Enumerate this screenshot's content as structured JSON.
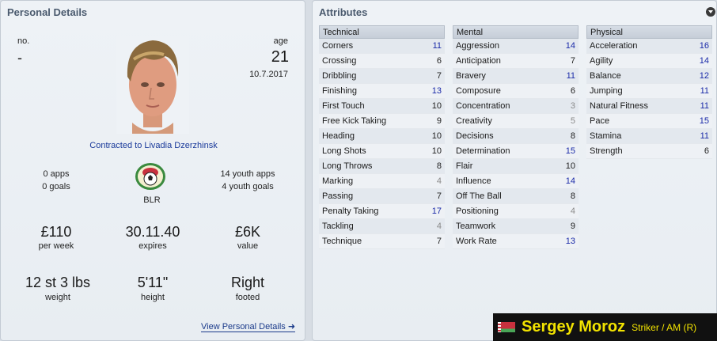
{
  "personal": {
    "title": "Personal Details",
    "no_label": "no.",
    "no_value": "-",
    "age_label": "age",
    "age_value": "21",
    "dob": "10.7.2017",
    "contract": "Contracted to Livadia Dzerzhinsk",
    "apps": "0 apps",
    "goals": "0 goals",
    "nation": "BLR",
    "youth_apps": "14 youth apps",
    "youth_goals": "4 youth goals",
    "wage": "£110",
    "wage_label": "per week",
    "expires": "30.11.40",
    "expires_label": "expires",
    "value": "£6K",
    "value_label": "value",
    "weight": "12 st 3 lbs",
    "weight_label": "weight",
    "height": "5'11\"",
    "height_label": "height",
    "footed": "Right",
    "footed_label": "footed",
    "view_link": "View Personal Details"
  },
  "attributes": {
    "title": "Attributes",
    "technical": {
      "header": "Technical",
      "items": [
        {
          "name": "Corners",
          "value": "11"
        },
        {
          "name": "Crossing",
          "value": "6"
        },
        {
          "name": "Dribbling",
          "value": "7"
        },
        {
          "name": "Finishing",
          "value": "13"
        },
        {
          "name": "First Touch",
          "value": "10"
        },
        {
          "name": "Free Kick Taking",
          "value": "9"
        },
        {
          "name": "Heading",
          "value": "10"
        },
        {
          "name": "Long Shots",
          "value": "10"
        },
        {
          "name": "Long Throws",
          "value": "8"
        },
        {
          "name": "Marking",
          "value": "4"
        },
        {
          "name": "Passing",
          "value": "7"
        },
        {
          "name": "Penalty Taking",
          "value": "17"
        },
        {
          "name": "Tackling",
          "value": "4"
        },
        {
          "name": "Technique",
          "value": "7"
        }
      ]
    },
    "mental": {
      "header": "Mental",
      "items": [
        {
          "name": "Aggression",
          "value": "14"
        },
        {
          "name": "Anticipation",
          "value": "7"
        },
        {
          "name": "Bravery",
          "value": "11"
        },
        {
          "name": "Composure",
          "value": "6"
        },
        {
          "name": "Concentration",
          "value": "3"
        },
        {
          "name": "Creativity",
          "value": "5"
        },
        {
          "name": "Decisions",
          "value": "8"
        },
        {
          "name": "Determination",
          "value": "15"
        },
        {
          "name": "Flair",
          "value": "10"
        },
        {
          "name": "Influence",
          "value": "14"
        },
        {
          "name": "Off The Ball",
          "value": "8"
        },
        {
          "name": "Positioning",
          "value": "4"
        },
        {
          "name": "Teamwork",
          "value": "9"
        },
        {
          "name": "Work Rate",
          "value": "13"
        }
      ]
    },
    "physical": {
      "header": "Physical",
      "items": [
        {
          "name": "Acceleration",
          "value": "16"
        },
        {
          "name": "Agility",
          "value": "14"
        },
        {
          "name": "Balance",
          "value": "12"
        },
        {
          "name": "Jumping",
          "value": "11"
        },
        {
          "name": "Natural Fitness",
          "value": "11"
        },
        {
          "name": "Pace",
          "value": "15"
        },
        {
          "name": "Stamina",
          "value": "11"
        },
        {
          "name": "Strength",
          "value": "6"
        }
      ]
    }
  },
  "player": {
    "name": "Sergey Moroz",
    "position": "Striker / AM (R)"
  },
  "icons": {
    "collapse": "chevron-down-icon",
    "link_arrow": "arrow-right-icon",
    "flag": "belarus-flag-icon",
    "badge": "football-federation-badge",
    "photo": "player-photo"
  },
  "colors": {
    "attr_high": "#1a2aa8",
    "attr_low": "#8a8a8a",
    "nameplate_text": "#f2e300",
    "nameplate_bg": "#111111"
  }
}
